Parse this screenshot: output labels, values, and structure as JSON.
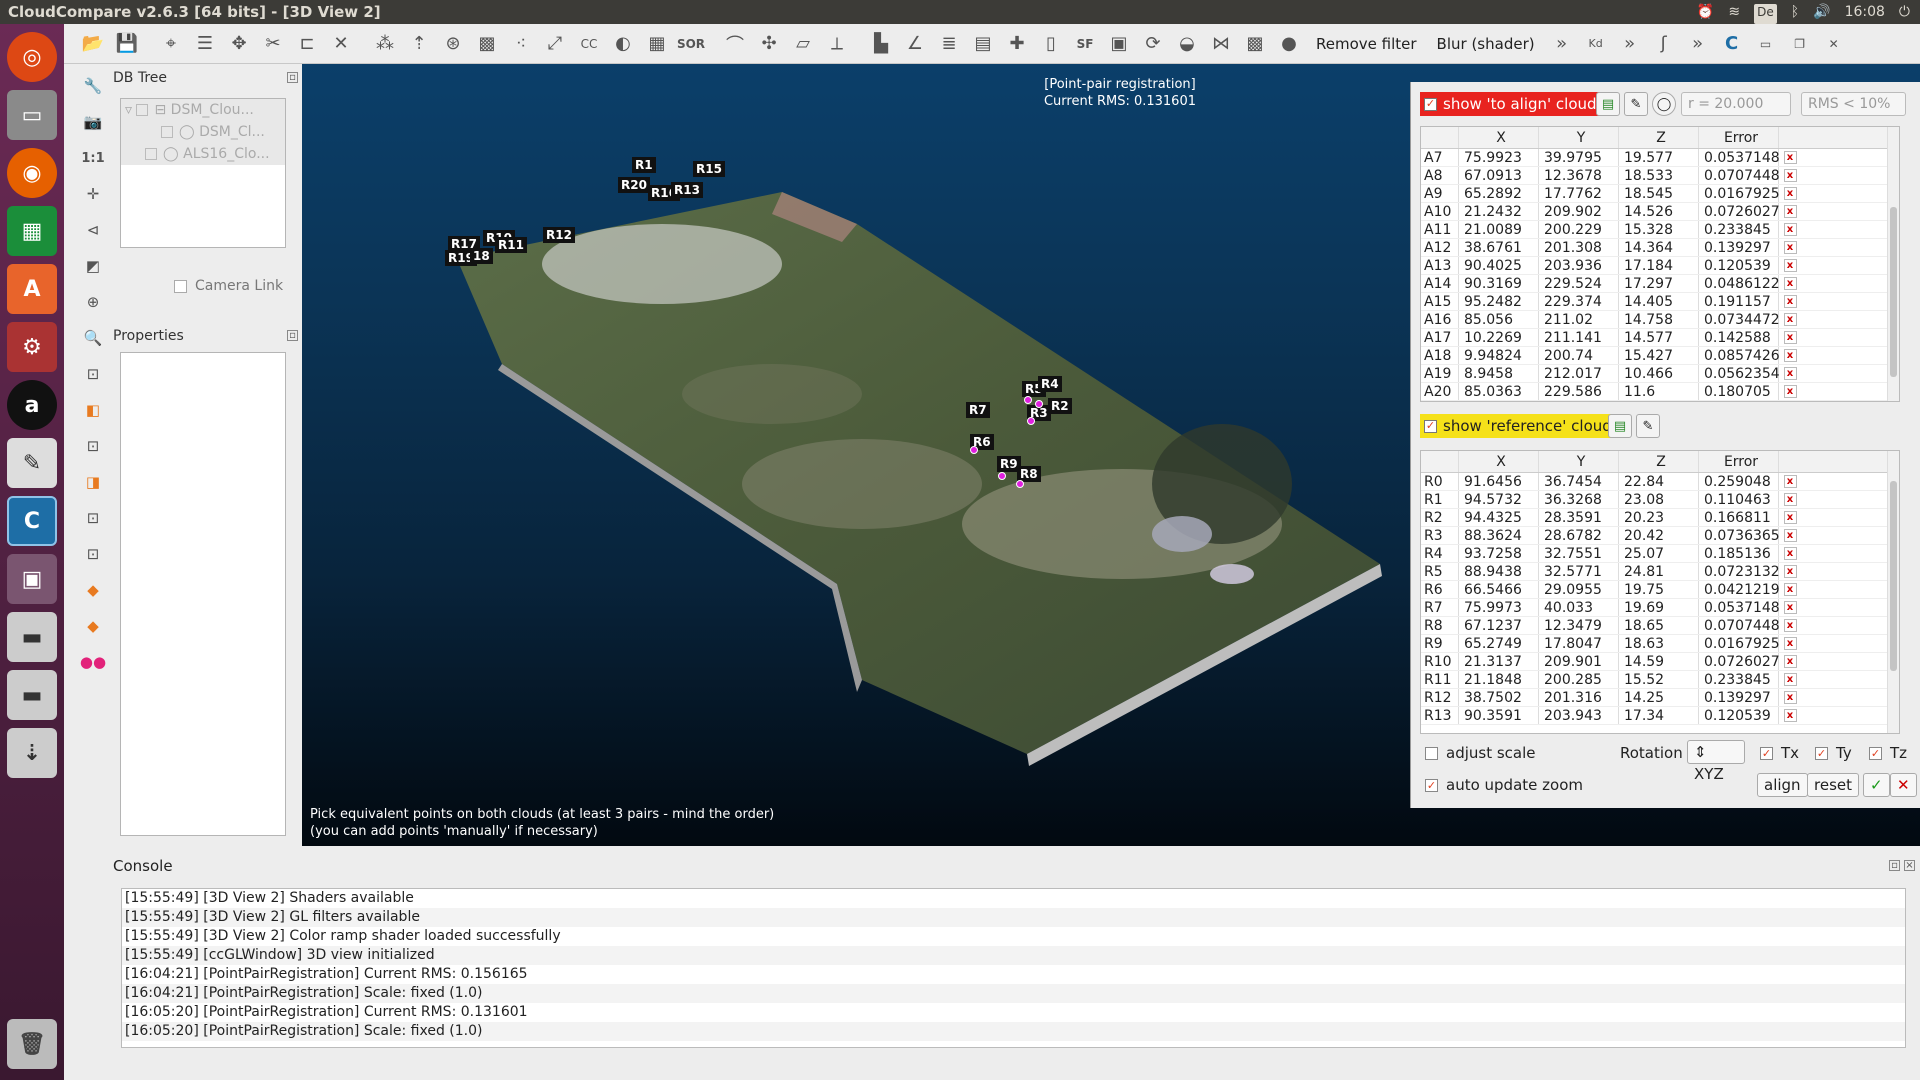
{
  "window": {
    "title": "CloudCompare v2.6.3 [64 bits] - [3D View 2]"
  },
  "tray": {
    "keyboard": "De",
    "time": "16:08"
  },
  "toolbar": {
    "remove_filter": "Remove filter",
    "blur": "Blur (shader)",
    "sf": "SF",
    "sor": "SOR",
    "cc": "CC",
    "kd": "Kd"
  },
  "left": {
    "db_tree_title": "DB Tree",
    "tree": [
      "DSM_Clou...",
      "DSM_Cl...",
      "ALS16_Clo..."
    ],
    "camera_link": "Camera Link",
    "properties_title": "Properties",
    "tools": [
      "1:1"
    ]
  },
  "view": {
    "title": "[Point-pair registration]",
    "rms": "Current RMS: 0.131601",
    "hint1": "Pick equivalent points on both clouds (at least 3 pairs - mind the order)",
    "hint2": "(you can add points 'manually' if necessary)",
    "labels": [
      "R15",
      "R20",
      "R16",
      "R13",
      "R12",
      "R17",
      "R19",
      "18",
      "R10",
      "R11",
      "R5",
      "R4",
      "R2",
      "R3",
      "R7",
      "R6",
      "R9",
      "R8",
      "R1"
    ]
  },
  "reg": {
    "show_align": "show 'to align' cloud",
    "radius": "r = 20.000",
    "rms_limit": "RMS < 10%",
    "show_ref": "show 'reference' cloud",
    "headers": [
      "X",
      "Y",
      "Z",
      "Error"
    ],
    "align_rows": [
      [
        "A7",
        "75.9923",
        "39.9795",
        "19.577",
        "0.0537148"
      ],
      [
        "A8",
        "67.0913",
        "12.3678",
        "18.533",
        "0.0707448"
      ],
      [
        "A9",
        "65.2892",
        "17.7762",
        "18.545",
        "0.0167925"
      ],
      [
        "A10",
        "21.2432",
        "209.902",
        "14.526",
        "0.0726027"
      ],
      [
        "A11",
        "21.0089",
        "200.229",
        "15.328",
        "0.233845"
      ],
      [
        "A12",
        "38.6761",
        "201.308",
        "14.364",
        "0.139297"
      ],
      [
        "A13",
        "90.4025",
        "203.936",
        "17.184",
        "0.120539"
      ],
      [
        "A14",
        "90.3169",
        "229.524",
        "17.297",
        "0.0486122"
      ],
      [
        "A15",
        "95.2482",
        "229.374",
        "14.405",
        "0.191157"
      ],
      [
        "A16",
        "85.056",
        "211.02",
        "14.758",
        "0.0734472"
      ],
      [
        "A17",
        "10.2269",
        "211.141",
        "14.577",
        "0.142588"
      ],
      [
        "A18",
        "9.94824",
        "200.74",
        "15.427",
        "0.0857426"
      ],
      [
        "A19",
        "8.9458",
        "212.017",
        "10.466",
        "0.0562354"
      ],
      [
        "A20",
        "85.0363",
        "229.586",
        "11.6",
        "0.180705"
      ]
    ],
    "ref_rows": [
      [
        "R0",
        "91.6456",
        "36.7454",
        "22.84",
        "0.259048"
      ],
      [
        "R1",
        "94.5732",
        "36.3268",
        "23.08",
        "0.110463"
      ],
      [
        "R2",
        "94.4325",
        "28.3591",
        "20.23",
        "0.166811"
      ],
      [
        "R3",
        "88.3624",
        "28.6782",
        "20.42",
        "0.0736365"
      ],
      [
        "R4",
        "93.7258",
        "32.7551",
        "25.07",
        "0.185136"
      ],
      [
        "R5",
        "88.9438",
        "32.5771",
        "24.81",
        "0.0723132"
      ],
      [
        "R6",
        "66.5466",
        "29.0955",
        "19.75",
        "0.0421219"
      ],
      [
        "R7",
        "75.9973",
        "40.033",
        "19.69",
        "0.0537148"
      ],
      [
        "R8",
        "67.1237",
        "12.3479",
        "18.65",
        "0.0707448"
      ],
      [
        "R9",
        "65.2749",
        "17.8047",
        "18.63",
        "0.0167925"
      ],
      [
        "R10",
        "21.3137",
        "209.901",
        "14.59",
        "0.0726027"
      ],
      [
        "R11",
        "21.1848",
        "200.285",
        "15.52",
        "0.233845"
      ],
      [
        "R12",
        "38.7502",
        "201.316",
        "14.25",
        "0.139297"
      ],
      [
        "R13",
        "90.3591",
        "203.943",
        "17.34",
        "0.120539"
      ]
    ],
    "adjust_scale": "adjust scale",
    "rotation_label": "Rotation",
    "rotation_value": "XYZ",
    "tx": "Tx",
    "ty": "Ty",
    "tz": "Tz",
    "auto_zoom": "auto update zoom",
    "align_btn": "align",
    "reset_btn": "reset"
  },
  "console": {
    "title": "Console",
    "lines": [
      "[15:55:49] [3D View 2] Shaders available",
      "[15:55:49] [3D View 2] GL filters available",
      "[15:55:49] [3D View 2] Color ramp shader loaded successfully",
      "[15:55:49] [ccGLWindow] 3D view initialized",
      "[16:04:21] [PointPairRegistration] Current RMS: 0.156165",
      "[16:04:21] [PointPairRegistration] Scale: fixed (1.0)",
      "[16:05:20] [PointPairRegistration] Current RMS: 0.131601",
      "[16:05:20] [PointPairRegistration] Scale: fixed (1.0)"
    ]
  },
  "colors": {
    "align_highlight": "#e8231f",
    "ref_highlight": "#f5e11a",
    "picked_point": "#e020e0"
  },
  "icons": [
    "ubuntu-icon",
    "files-icon",
    "firefox-icon",
    "calc-icon",
    "software-center-icon",
    "settings-icon",
    "amazon-icon",
    "text-editor-icon",
    "cloudcompare-icon",
    "trash-icon"
  ]
}
